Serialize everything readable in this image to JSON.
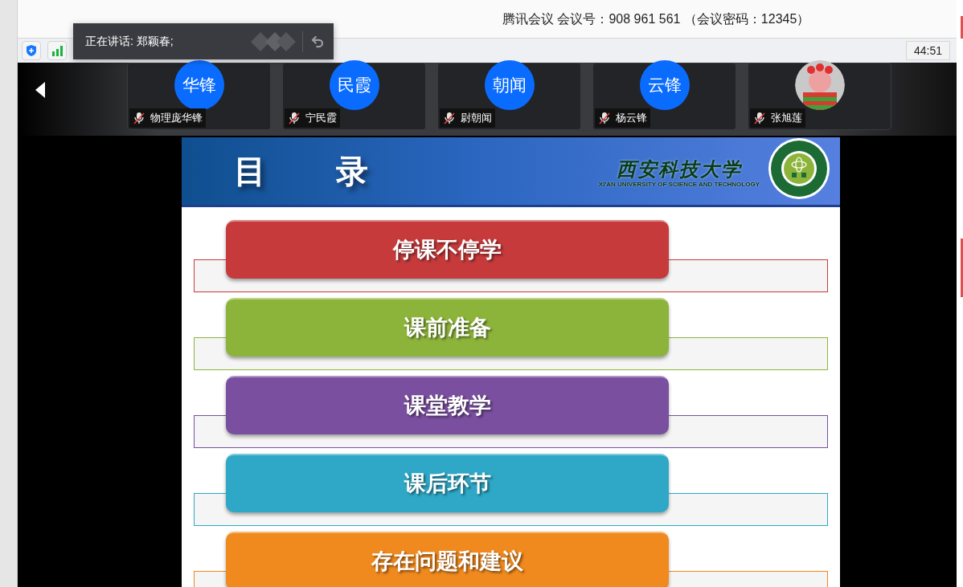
{
  "window": {
    "title": "腾讯会议 会议号：908 961 561 （会议密码：12345）"
  },
  "toolbar": {
    "timer": "44:51"
  },
  "speaking_toast": {
    "text": "正在讲话: 郑颖春;"
  },
  "participants": [
    {
      "kind": "initials",
      "initials": "华锋",
      "name": "物理庞华锋",
      "muted": true
    },
    {
      "kind": "initials",
      "initials": "民霞",
      "name": "宁民霞",
      "muted": true
    },
    {
      "kind": "initials",
      "initials": "朝闻",
      "name": "尉朝闻",
      "muted": true
    },
    {
      "kind": "initials",
      "initials": "云锋",
      "name": "杨云锋",
      "muted": true
    },
    {
      "kind": "picture",
      "name": "张旭莲",
      "muted": true
    }
  ],
  "slide": {
    "title_chars": [
      "目",
      "录"
    ],
    "logo_name": "西安科技大学",
    "logo_subtitle": "XI'AN UNIVERSITY OF SCIENCE AND TECHNOLOGY",
    "items": [
      {
        "label": "停课不停学",
        "color": "#c63a3b"
      },
      {
        "label": "课前准备",
        "color": "#8db43a"
      },
      {
        "label": "课堂教学",
        "color": "#7a4f9f"
      },
      {
        "label": "课后环节",
        "color": "#2ea8c6"
      },
      {
        "label": "存在问题和建议",
        "color": "#f08a1f"
      }
    ]
  }
}
